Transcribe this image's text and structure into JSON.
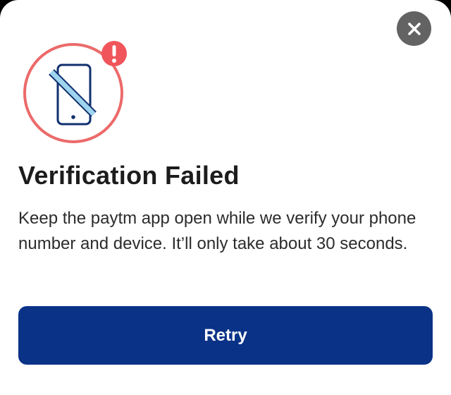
{
  "dialog": {
    "title": "Verification Failed",
    "message": "Keep the paytm app open while we verify your phone number and device. It’ll only take about 30 seconds.",
    "retry_label": "Retry",
    "icons": {
      "close": "close-icon",
      "illustration": "phone-blocked-icon",
      "alert": "alert-badge-icon"
    },
    "colors": {
      "primary_button": "#0a3286",
      "alert_red": "#f0555b",
      "ring_red": "#ec6a6a",
      "phone_navy": "#10306f",
      "slash_blue": "#9fd4ef",
      "close_bg": "#636363"
    }
  }
}
